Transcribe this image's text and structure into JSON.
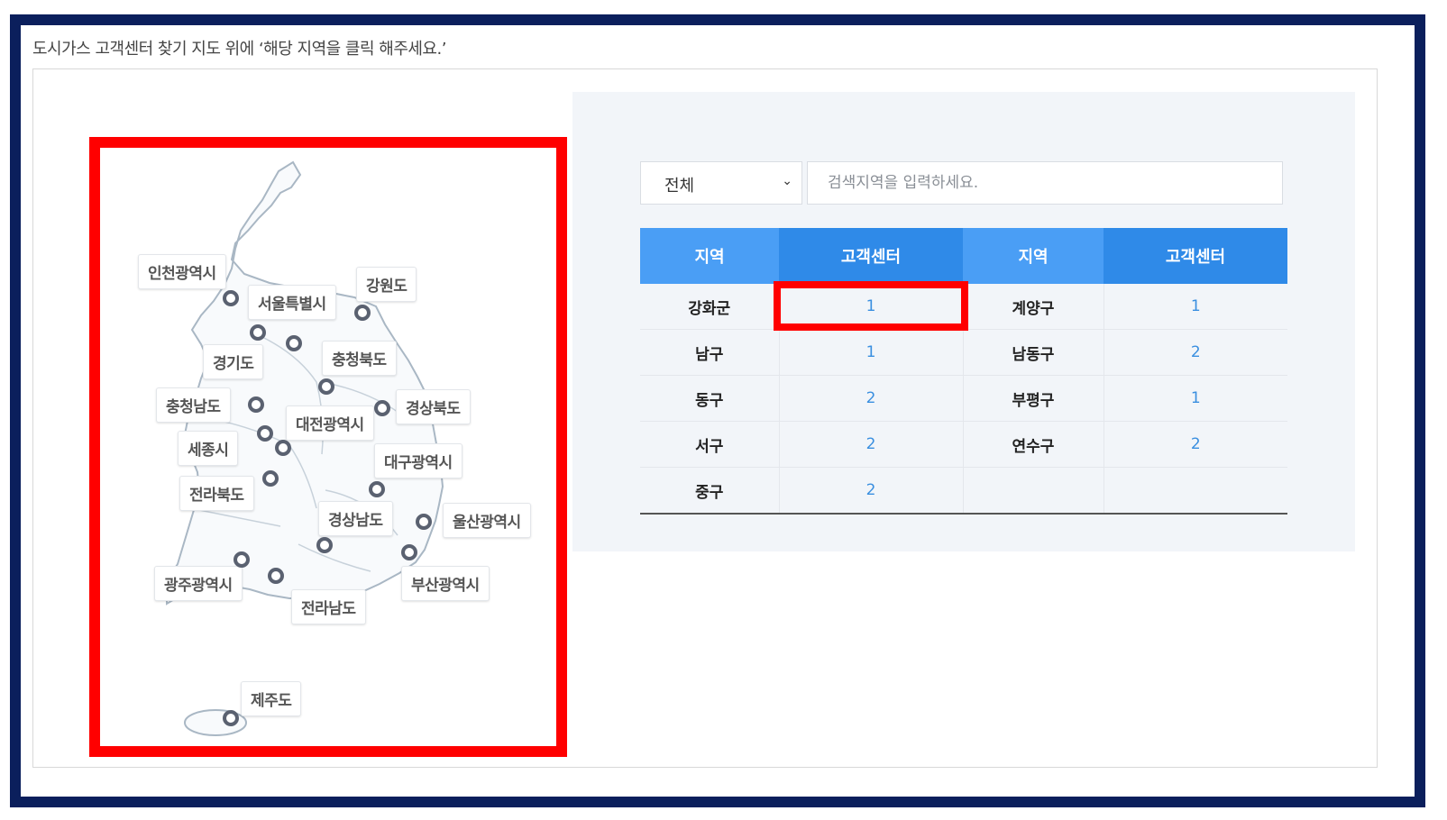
{
  "instruction": "도시가스 고객센터 찾기 지도 위에 ‘해당 지역을 클릭 해주세요.’",
  "map": {
    "labels": {
      "incheon": "인천광역시",
      "seoul": "서울특별시",
      "gangwon": "강원도",
      "gyeonggi": "경기도",
      "chungbuk": "충청북도",
      "chungnam": "충청남도",
      "gyeongbuk": "경상북도",
      "daejeon": "대전광역시",
      "sejong": "세종시",
      "daegu": "대구광역시",
      "jeonbuk": "전라북도",
      "gyeongnam": "경상남도",
      "ulsan": "울산광역시",
      "gwangju": "광주광역시",
      "busan": "부산광역시",
      "jeonnam": "전라남도",
      "jeju": "제주도"
    }
  },
  "filter": {
    "selected": "전체",
    "search_placeholder": "검색지역을 입력하세요."
  },
  "table": {
    "headers": [
      "지역",
      "고객센터",
      "지역",
      "고객센터"
    ],
    "rows": [
      {
        "region1": "강화군",
        "count1": "1",
        "region2": "계양구",
        "count2": "1"
      },
      {
        "region1": "남구",
        "count1": "1",
        "region2": "남동구",
        "count2": "2"
      },
      {
        "region1": "동구",
        "count1": "2",
        "region2": "부평구",
        "count2": "1"
      },
      {
        "region1": "서구",
        "count1": "2",
        "region2": "연수구",
        "count2": "2"
      },
      {
        "region1": "중구",
        "count1": "2",
        "region2": "",
        "count2": ""
      }
    ]
  },
  "colors": {
    "frame_border": "#0b1f5c",
    "highlight": "#ff0000",
    "header_light": "#4a9ef5",
    "header_dark": "#2f8ae8",
    "count_text": "#3a8fe0"
  }
}
